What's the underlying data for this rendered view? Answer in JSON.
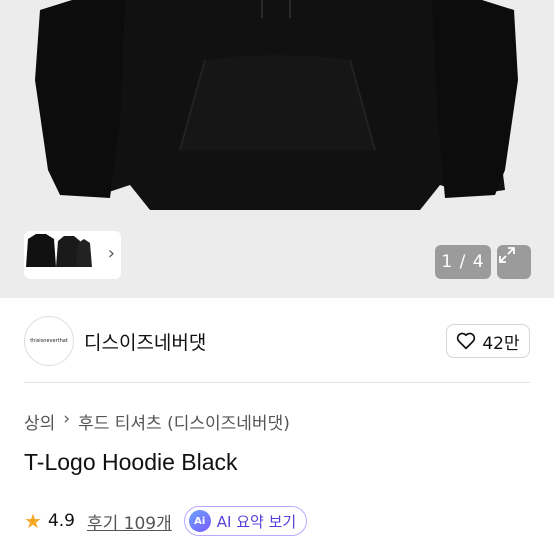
{
  "gallery": {
    "counter": "1 / 4",
    "thumb_chevron": "›"
  },
  "brand": {
    "logo_text": "thisisneverthat",
    "name": "디스이즈네버댓",
    "likes": "42만"
  },
  "breadcrumb": {
    "root": "상의",
    "separator": "›",
    "current": "후드 티셔츠 (디스이즈네버댓)"
  },
  "product": {
    "title": "T-Logo Hoodie Black"
  },
  "rating": {
    "score": "4.9",
    "reviews": "후기 109개",
    "ai_badge": "Ai",
    "ai_label": "AI 요약 보기"
  },
  "colors": {
    "star": "#f5a623",
    "ai_accent": "#7b5cff"
  }
}
